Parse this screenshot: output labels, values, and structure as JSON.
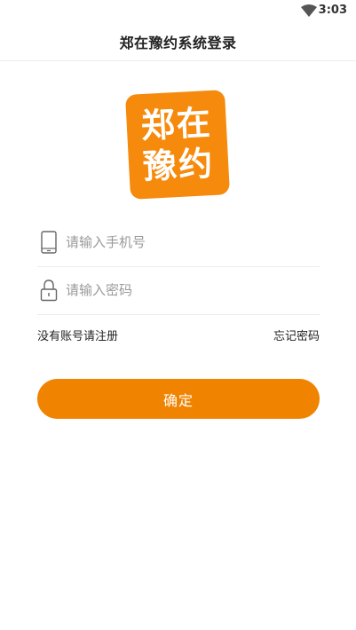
{
  "status_bar": {
    "time": "3:03",
    "wifi_icon": "wifi-icon"
  },
  "nav": {
    "title": "郑在豫约系统登录"
  },
  "logo": {
    "line1": "郑在",
    "line2": "豫约",
    "color": "#f58a0c"
  },
  "form": {
    "phone": {
      "placeholder": "请输入手机号",
      "value": "",
      "icon": "phone-icon"
    },
    "password": {
      "placeholder": "请输入密码",
      "value": "",
      "icon": "lock-icon"
    }
  },
  "links": {
    "register": "没有账号请注册",
    "forgot": "忘记密码"
  },
  "confirm_button": {
    "label": "确定",
    "color": "#f08300"
  }
}
